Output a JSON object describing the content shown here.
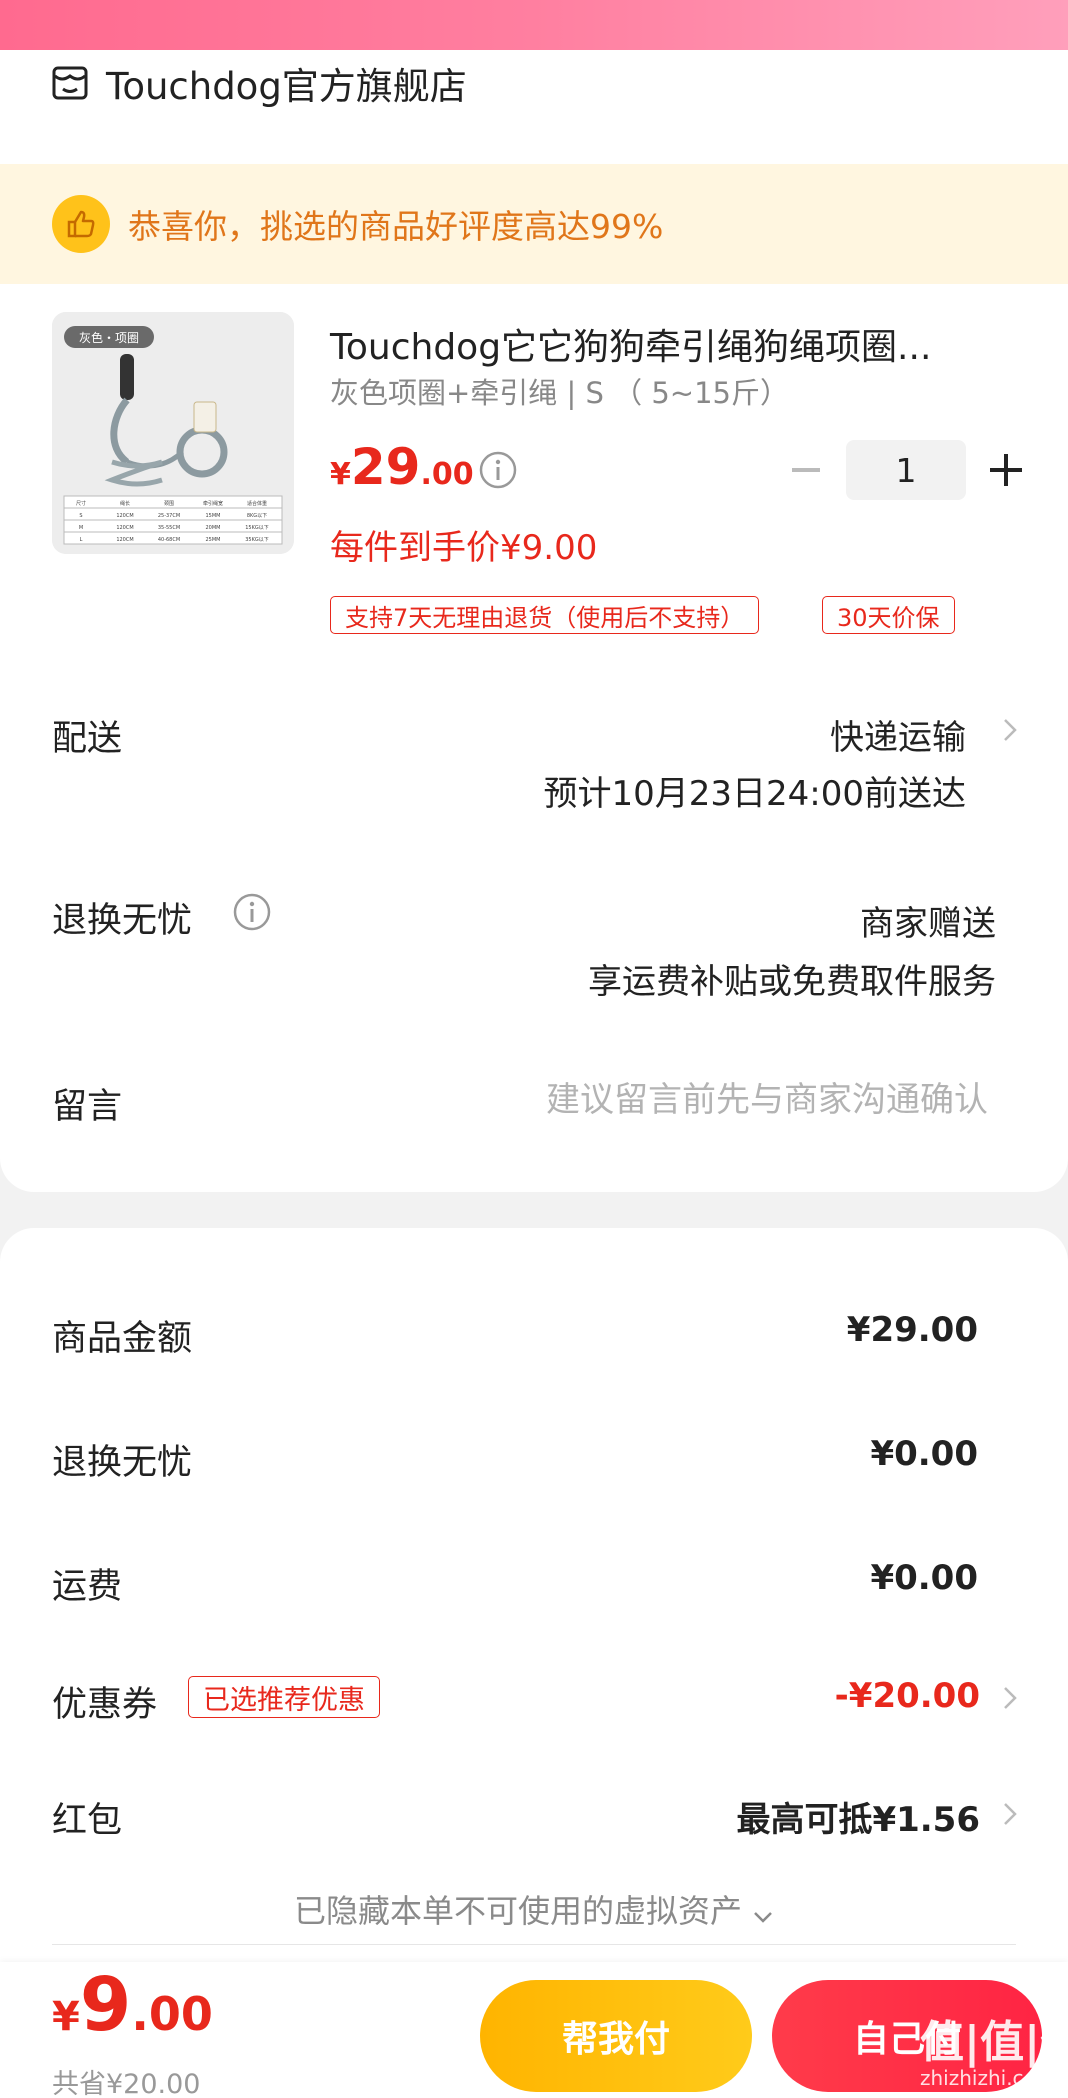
{
  "store": {
    "name": "Touchdog官方旗舰店",
    "icon": "store-icon"
  },
  "praise": {
    "text": "恭喜你，挑选的商品好评度高达99%",
    "icon": "thumbs-up-icon"
  },
  "product": {
    "title": "Touchdog它它狗狗牵引绳狗绳项圈...",
    "spec": "灰色项圈+牵引绳 | S （ 5~15斤）",
    "price_symbol": "¥",
    "price_int": "29",
    "price_dec": ".00",
    "quantity": "1",
    "unit_price": "每件到手价¥9.00",
    "tags": [
      "支持7天无理由退货（使用后不支持）",
      "30天价保"
    ],
    "image": {
      "badge": "灰色・项圈",
      "size_table": [
        [
          "尺寸",
          "绳长",
          "颈围",
          "牵引绳宽",
          "适合体重"
        ],
        [
          "S",
          "120CM",
          "25-37CM",
          "15MM",
          "8KG以下"
        ],
        [
          "M",
          "120CM",
          "35-55CM",
          "20MM",
          "15KG以下"
        ],
        [
          "L",
          "120CM",
          "40-68CM",
          "25MM",
          "35KG以下"
        ]
      ]
    }
  },
  "delivery": {
    "label": "配送",
    "method": "快递运输",
    "eta": "预计10月23日24:00前送达"
  },
  "worry_free": {
    "label": "退换无忧",
    "value": "商家赠送",
    "detail": "享运费补贴或免费取件服务"
  },
  "message": {
    "label": "留言",
    "placeholder": "建议留言前先与商家沟通确认"
  },
  "summary": {
    "goods_amount_label": "商品金额",
    "goods_amount": "¥29.00",
    "worry_fee_label": "退换无忧",
    "worry_fee": "¥0.00",
    "shipping_label": "运费",
    "shipping": "¥0.00",
    "coupon_label": "优惠券",
    "coupon_badge": "已选推荐优惠",
    "coupon_value": "-¥20.00",
    "redpacket_label": "红包",
    "redpacket_value": "最高可抵¥1.56",
    "hidden_assets": "已隐藏本单不可使用的虚拟资产"
  },
  "footer": {
    "total_symbol": "¥",
    "total_int": "9",
    "total_dec": ".00",
    "saved": "共省¥20.00",
    "help_pay_label": "帮我付",
    "self_pay_label": "自己付",
    "watermark": "值|值|值",
    "watermark_url": "zhizhizhi.com"
  },
  "colors": {
    "accent_red": "#e8281c",
    "gold": "#ffb400",
    "praise_orange": "#e0761a"
  }
}
